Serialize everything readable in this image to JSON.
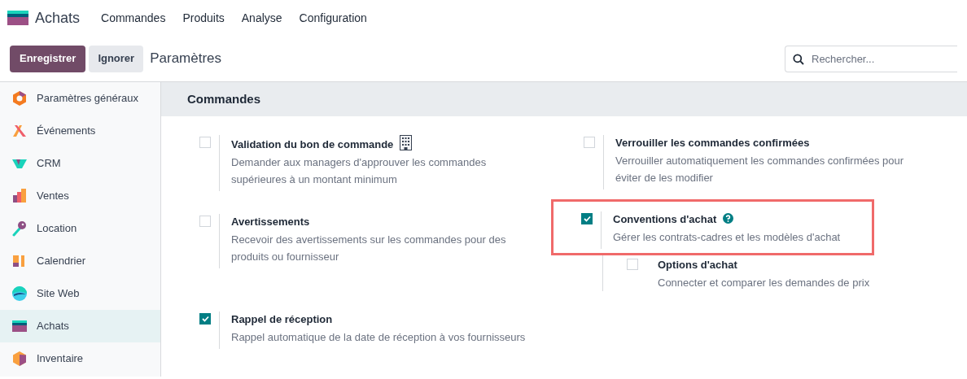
{
  "navbar": {
    "app": "Achats",
    "menu": [
      "Commandes",
      "Produits",
      "Analyse",
      "Configuration"
    ]
  },
  "control_panel": {
    "save": "Enregistrer",
    "discard": "Ignorer",
    "breadcrumb": "Paramètres",
    "search": {
      "placeholder": "Rechercher..."
    }
  },
  "sidebar": {
    "items": [
      {
        "label": "Paramètres généraux",
        "selected": false
      },
      {
        "label": "Événements",
        "selected": false
      },
      {
        "label": "CRM",
        "selected": false
      },
      {
        "label": "Ventes",
        "selected": false
      },
      {
        "label": "Location",
        "selected": false
      },
      {
        "label": "Calendrier",
        "selected": false
      },
      {
        "label": "Site Web",
        "selected": false
      },
      {
        "label": "Achats",
        "selected": true
      },
      {
        "label": "Inventaire",
        "selected": false
      }
    ]
  },
  "section": {
    "title": "Commandes",
    "settings": [
      {
        "title": "Validation du bon de commande",
        "description": "Demander aux managers d'approuver les commandes supérieures à un montant minimum",
        "checked": false,
        "kind": "enterprise",
        "highlighted": false
      },
      {
        "title": "Verrouiller les commandes confirmées",
        "description": "Verrouiller automatiquement les commandes confirmées pour éviter de les modifier",
        "checked": false,
        "kind": "plain",
        "highlighted": false
      },
      {
        "title": "Avertissements",
        "description": "Recevoir des avertissements sur les commandes pour des produits ou fournisseur",
        "checked": false,
        "kind": "plain",
        "highlighted": false
      },
      {
        "title": "Conventions d'achat",
        "description": "Gérer les contrats-cadres et les modèles d'achat",
        "checked": true,
        "kind": "help",
        "highlighted": true,
        "children": [
          {
            "title": "Options d'achat",
            "description": "Connecter et comparer les demandes de prix",
            "checked": false
          }
        ]
      },
      {
        "title": "Rappel de réception",
        "description": "Rappel automatique de la date de réception à vos fournisseurs",
        "checked": true,
        "kind": "plain",
        "highlighted": false
      }
    ]
  }
}
